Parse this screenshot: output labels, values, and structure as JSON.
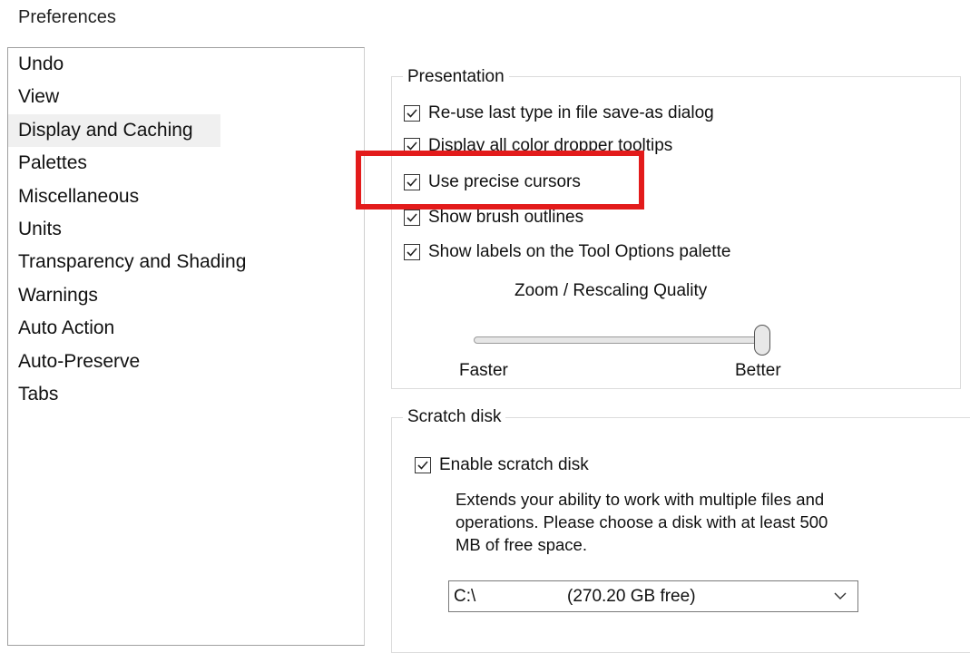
{
  "window": {
    "title": "Preferences"
  },
  "categories": [
    {
      "label": "Undo"
    },
    {
      "label": "View"
    },
    {
      "label": "Display and Caching",
      "selected": true
    },
    {
      "label": "Palettes"
    },
    {
      "label": "Miscellaneous"
    },
    {
      "label": "Units"
    },
    {
      "label": "Transparency and Shading"
    },
    {
      "label": "Warnings"
    },
    {
      "label": "Auto Action"
    },
    {
      "label": "Auto-Preserve"
    },
    {
      "label": "Tabs"
    }
  ],
  "presentation": {
    "title": "Presentation",
    "options": [
      {
        "label": "Re-use last type in file save-as dialog",
        "checked": true
      },
      {
        "label": "Display all color dropper tooltips",
        "checked": true
      },
      {
        "label": "Use precise cursors",
        "checked": true
      },
      {
        "label": "Show brush outlines",
        "checked": true
      },
      {
        "label": "Show labels on the Tool Options palette",
        "checked": true
      }
    ],
    "zoom": {
      "label": "Zoom / Rescaling Quality",
      "min_label": "Faster",
      "max_label": "Better",
      "value_fraction": 1.0
    }
  },
  "scratch": {
    "title": "Scratch disk",
    "enable_label": "Enable scratch disk",
    "enabled": true,
    "description": "Extends your ability to work with multiple files and operations. Please choose a disk with at least 500 MB of free space.",
    "disk": {
      "drive": "C:\\",
      "free": "(270.20 GB free)"
    }
  },
  "colors": {
    "highlight": "#e31b1b",
    "selection": "#f0f0f0"
  }
}
